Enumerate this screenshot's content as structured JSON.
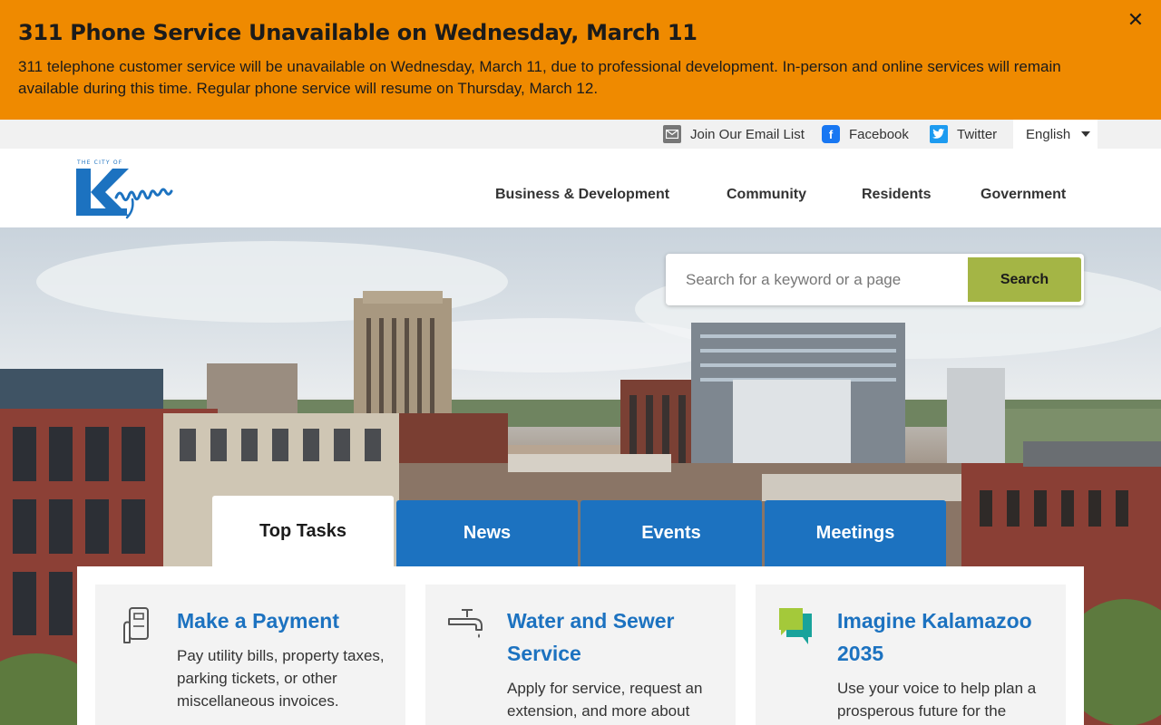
{
  "alert": {
    "title": "311 Phone Service Unavailable on Wednesday, March 11",
    "body": "311 telephone customer service will be unavailable on Wednesday, March 11, due to professional development. In-person and online services will remain available during this time. Regular phone service will resume on Thursday, March 12.",
    "close_label": "✕"
  },
  "utility": {
    "email": "Join Our Email List",
    "facebook": "Facebook",
    "twitter": "Twitter",
    "language": "English"
  },
  "logo": {
    "top_text": "THE CITY OF",
    "name": "Kalamazoo"
  },
  "nav": [
    {
      "label": "Business & Development"
    },
    {
      "label": "Community"
    },
    {
      "label": "Residents"
    },
    {
      "label": "Government"
    }
  ],
  "search": {
    "placeholder": "Search for a keyword or a page",
    "button": "Search"
  },
  "tabs": [
    {
      "label": "Top Tasks",
      "active": true
    },
    {
      "label": "News"
    },
    {
      "label": "Events"
    },
    {
      "label": "Meetings"
    }
  ],
  "cards": [
    {
      "title": "Make a Payment",
      "desc": "Pay utility bills, property taxes, parking tickets, or other miscellaneous invoices.",
      "icon": "card-payment-icon"
    },
    {
      "title": "Water and Sewer Service",
      "desc": "Apply for service, request an extension, and more about",
      "icon": "faucet-icon"
    },
    {
      "title": "Imagine Kalamazoo 2035",
      "desc": "Use your voice to help plan a prosperous future for the",
      "icon": "chat-bubbles-icon"
    }
  ],
  "colors": {
    "alert": "#ef8a00",
    "brand_blue": "#1c72c0",
    "search_button": "#a4b545"
  }
}
